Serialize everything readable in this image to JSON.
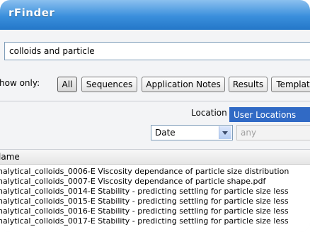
{
  "window": {
    "title": "rFinder"
  },
  "search": {
    "value": "colloids and particle"
  },
  "filters": {
    "show_only_label": "how only:",
    "buttons": [
      "All",
      "Sequences",
      "Application Notes",
      "Results",
      "Templat"
    ],
    "active": "All"
  },
  "location": {
    "label": "Location",
    "value": "User Locations"
  },
  "date_filter": {
    "value": "Date",
    "range_value": "any"
  },
  "results": {
    "column_header": "lame",
    "rows": [
      "nalytical_colloids_0006-E Viscosity dependance of particle size  distribution",
      "nalytical_colloids_0007-E Viscosity dependance of particle shape.pdf",
      "nalytical_colloids_0014-E Stability - predicting settling for particle size less",
      "nalytical_colloids_0015-E Stability - predicting settling for particle size less",
      "nalytical_colloids_0016-E Stability - predicting settling for particle size less",
      "nalytical_colloids_0017-E Stability - predicting settling for particle size less"
    ]
  },
  "colors": {
    "titlebar": "#3a8fdc",
    "selection": "#316ac5"
  }
}
